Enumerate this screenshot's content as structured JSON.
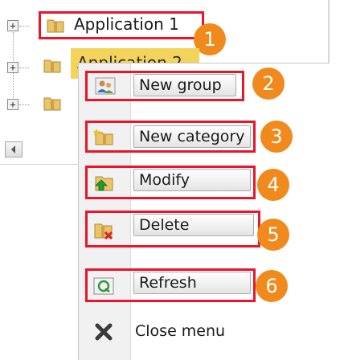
{
  "tree": {
    "nodes": [
      {
        "label": "Application 1",
        "expander": "+"
      },
      {
        "label": "Application 2",
        "expander": "+"
      },
      {
        "label": "",
        "expander": "+"
      }
    ],
    "scroll_left_icon": "arrow-left-icon"
  },
  "context_menu": {
    "items": [
      {
        "label": "New group",
        "icon": "users-icon"
      },
      {
        "label": "New category",
        "icon": "new-folder-icon"
      },
      {
        "label": "Modify",
        "icon": "modify-icon"
      },
      {
        "label": "Delete",
        "icon": "delete-icon"
      },
      {
        "label": "Refresh",
        "icon": "refresh-icon"
      },
      {
        "label": "Close menu",
        "icon": "close-icon"
      }
    ]
  },
  "callouts": [
    "1",
    "2",
    "3",
    "4",
    "5",
    "6"
  ],
  "colors": {
    "highlight": "#e8152b",
    "badge": "#f08a1c",
    "folder": "#e9c46a"
  }
}
